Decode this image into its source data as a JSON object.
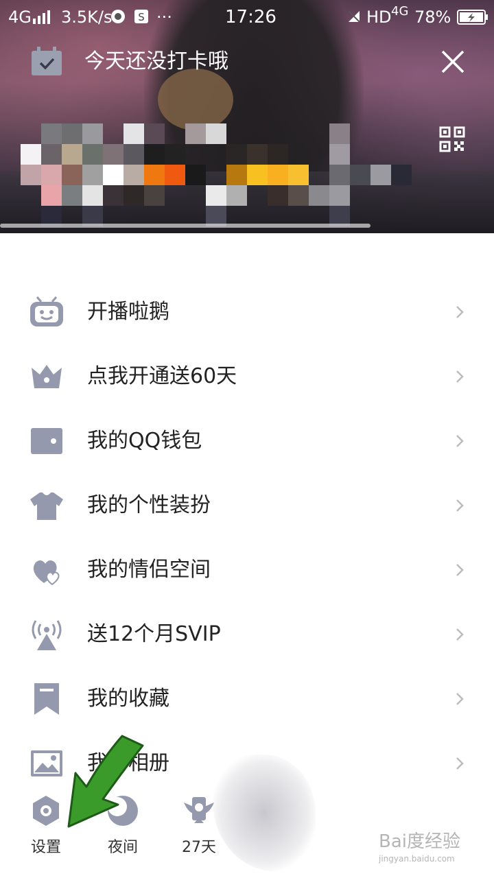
{
  "status_bar": {
    "network": "4G",
    "speed": "3.5K/s",
    "dots": "···",
    "time": "17:26",
    "hd": "HD",
    "net2": "4G",
    "battery": "78%"
  },
  "header": {
    "checkin_title": "今天还没打卡哦"
  },
  "menu": {
    "items": [
      {
        "label": "开播啦鹅",
        "icon": "tv-robot-icon"
      },
      {
        "label": "点我开通送60天",
        "icon": "crown-icon"
      },
      {
        "label": "我的QQ钱包",
        "icon": "wallet-icon"
      },
      {
        "label": "我的个性装扮",
        "icon": "tshirt-icon"
      },
      {
        "label": "我的情侣空间",
        "icon": "hearts-icon"
      },
      {
        "label": "送12个月SVIP",
        "icon": "broadcast-icon"
      },
      {
        "label": "我的收藏",
        "icon": "bookmark-icon"
      },
      {
        "label": "我的相册",
        "icon": "photo-icon"
      }
    ]
  },
  "bottom": {
    "settings": "设置",
    "night": "夜间",
    "days": "27天"
  },
  "watermark": {
    "brand": "Bai度经验",
    "url": "jingyan.baidu.com"
  },
  "colors": {
    "icon": "#9499ad",
    "arrow": "#3a9a2a",
    "text": "#222222"
  }
}
